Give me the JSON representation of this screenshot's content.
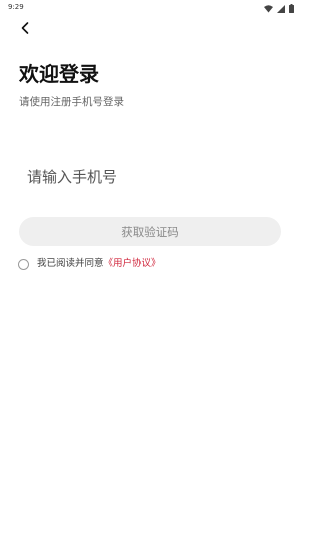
{
  "status_bar": {
    "time": "9:29",
    "icons": [
      "wifi-icon",
      "signal-icon",
      "battery-icon"
    ]
  },
  "header": {
    "back_icon": "back-arrow-icon"
  },
  "login": {
    "title": "欢迎登录",
    "subtitle": "请使用注册手机号登录",
    "phone_placeholder": "请输入手机号",
    "phone_value": "",
    "get_code_label": "获取验证码",
    "agree_text": "我已阅读并同意",
    "agreement_link": "《用户协议》",
    "agree_checked": false
  },
  "colors": {
    "accent": "#d0263c",
    "button_bg": "#efefef",
    "button_text": "#8a8a8a",
    "background": "#ffffff"
  }
}
